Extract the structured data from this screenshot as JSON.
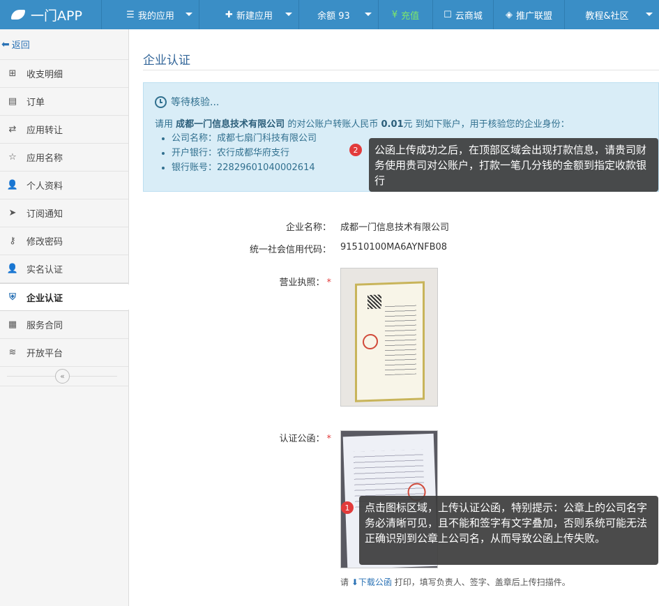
{
  "navbar": {
    "brand": "一门APP",
    "items": [
      {
        "label": "我的应用",
        "icon": "hamburger-icon"
      },
      {
        "label": "新建应用",
        "icon": "plus-icon"
      },
      {
        "label": "余额 93"
      },
      {
        "label": "充值",
        "icon": "yen-icon"
      },
      {
        "label": "云商城",
        "icon": "shop-icon"
      },
      {
        "label": "推广联盟",
        "icon": "diamond-icon"
      },
      {
        "label": "教程&社区"
      }
    ],
    "colors": {
      "bar": "#3a8ec6",
      "recharge": "#7de86b"
    }
  },
  "sidebar": {
    "back_label": "返回",
    "items": [
      {
        "label": "收支明细",
        "icon": "income-icon"
      },
      {
        "label": "订单",
        "icon": "order-icon"
      },
      {
        "label": "应用转让",
        "icon": "transfer-icon"
      },
      {
        "label": "应用名称",
        "icon": "star-doc-icon"
      },
      {
        "label": "个人资料",
        "icon": "user-icon"
      },
      {
        "label": "订阅通知",
        "icon": "send-icon"
      },
      {
        "label": "修改密码",
        "icon": "key-icon"
      },
      {
        "label": "实名认证",
        "icon": "user-check-icon"
      },
      {
        "label": "企业认证",
        "icon": "shield-icon",
        "active": true
      },
      {
        "label": "服务合同",
        "icon": "contract-icon"
      },
      {
        "label": "开放平台",
        "icon": "layers-icon"
      }
    ]
  },
  "main": {
    "title": "企业认证",
    "notice": {
      "status": "等待核验...",
      "msg_pre": "请用",
      "msg_company": "成都一门信息技术有限公司",
      "msg_mid": "的对公账户转账人民币",
      "msg_amount": "0.01",
      "msg_post": "元 到如下账户，用于核验您的企业身份：",
      "accounts": [
        "公司名称：成都七扇门科技有限公司",
        "开户银行：农行成都华府支行",
        "银行账号：22829601040002614"
      ]
    },
    "form": {
      "company_label": "企业名称：",
      "company_value": "成都一门信息技术有限公司",
      "credit_label": "统一社会信用代码：",
      "credit_value": "91510100MA6AYNFB08",
      "license_label": "营业执照：",
      "letter_label": "认证公函：",
      "required_mark": "*",
      "hint_pre": "请",
      "hint_link": "下载公函",
      "hint_post": "打印，填写负责人、签字、盖章后上传扫描件。"
    },
    "tooltips": [
      {
        "num": "2",
        "text": "公函上传成功之后，在顶部区域会出现打款信息，请贵司财务使用贵司对公账户，打款一笔几分钱的金额到指定收款银行"
      },
      {
        "num": "1",
        "text": "点击图标区域，上传认证公函，特别提示：公章上的公司名字务必清晰可见，且不能和签字有文字叠加，否则系统可能无法正确识别到公章上公司名，从而导致公函上传失败。"
      }
    ]
  }
}
